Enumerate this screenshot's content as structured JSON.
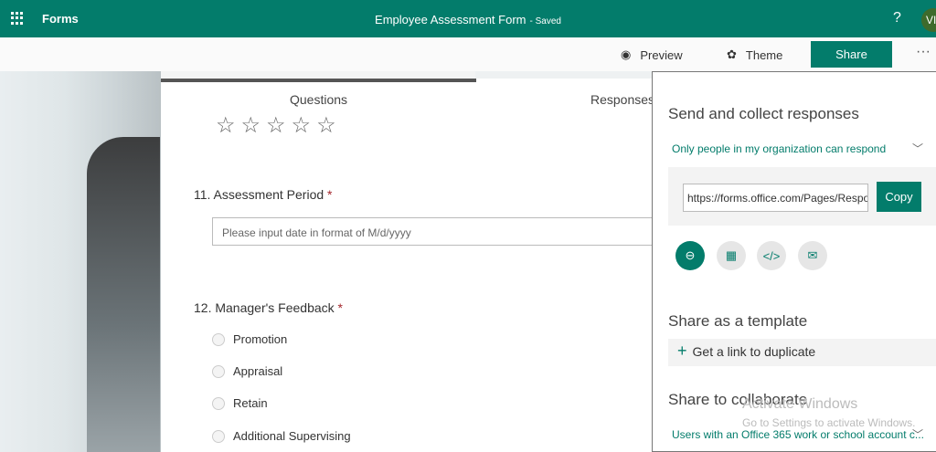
{
  "topbar": {
    "app": "Forms",
    "title": "Employee Assessment Form",
    "status": "- Saved",
    "help": "?",
    "avatar": "VI"
  },
  "commands": {
    "preview": "Preview",
    "theme": "Theme",
    "share": "Share",
    "more": "···"
  },
  "form": {
    "tabs": [
      "Questions",
      "Responses"
    ],
    "stars": "☆☆☆☆☆",
    "q11": {
      "label": "11. Assessment Period",
      "required": "*",
      "placeholder": "Please input date in format of M/d/yyyy"
    },
    "q12": {
      "label": "12. Manager's Feedback",
      "required": "*",
      "options": [
        "Promotion",
        "Appraisal",
        "Retain",
        "Additional Supervising"
      ]
    }
  },
  "panel": {
    "send_heading": "Send and collect responses",
    "audience": "Only people in my organization can respond",
    "url": "https://forms.office.com/Pages/ResponsePage.aspx",
    "copy": "Copy",
    "icons": [
      "link-icon",
      "qr-code-icon",
      "embed-icon",
      "email-icon"
    ],
    "template_heading": "Share as a template",
    "duplicate": "Get a link to duplicate",
    "collab_heading": "Share to collaborate",
    "collab_audience": "Users with an Office 365 work or school account c..."
  },
  "watermark": {
    "title": "Activate Windows",
    "subtitle": "Go to Settings to activate Windows."
  },
  "colors": {
    "accent": "#037c6b"
  }
}
